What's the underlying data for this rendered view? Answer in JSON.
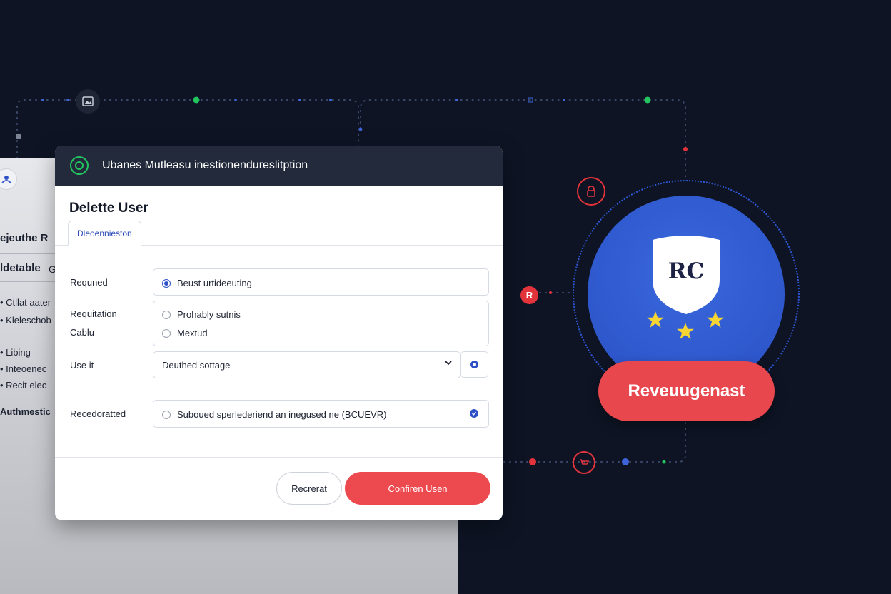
{
  "background": {
    "panel_texts": [
      "ejeuthe R",
      "ldetable",
      "G",
      "• Ctllat aater",
      "• Kleleschob",
      "• Libing",
      "• Inteoenec",
      "• Recit elec",
      "Authmestic"
    ]
  },
  "dialog": {
    "header_title": "Ubanes Mutleasu inestionendureslitption",
    "title": "Delette User",
    "tab_label": "Dleoennieston",
    "fields": {
      "required": {
        "label": "Requned",
        "option": "Beust urtideeuting"
      },
      "requitation": {
        "label_line1": "Requitation",
        "label_line2": "Cablu",
        "options": [
          "Prohably sutnis",
          "Mextud"
        ]
      },
      "use_it": {
        "label": "Use it",
        "value": "Deuthed sottage"
      },
      "recedorated": {
        "label": "Recedoratted",
        "option": "Suboued sperlederiend an inegused ne (BCUEVR)"
      }
    },
    "buttons": {
      "secondary": "Recrerat",
      "primary": "Confiren Usen"
    }
  },
  "badge": {
    "shield_text": "RC",
    "banner_text": "Reveuugenast",
    "node_letter": "R"
  },
  "colors": {
    "background": "#0e1424",
    "dialog_header": "#222a3b",
    "accent_blue": "#2f51c8",
    "accent_red": "#ec4a4f",
    "accent_green": "#22c55e",
    "star_yellow": "#f5d433"
  }
}
